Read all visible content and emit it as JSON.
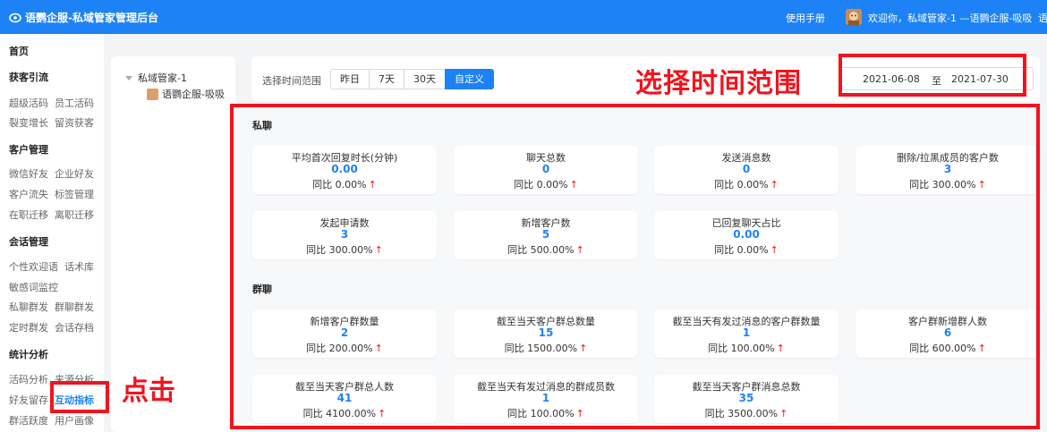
{
  "header": {
    "brand": "语鹦企服-私域管家管理后台",
    "manual": "使用手册",
    "welcome": "欢迎你，私域管家-1 —语鹦企服-吸吸",
    "overflow": "语"
  },
  "sidebar": {
    "home": "首页",
    "sections": [
      {
        "title": "获客引流",
        "items": [
          "超级活码",
          "员工活码",
          "裂变增长",
          "留资获客"
        ]
      },
      {
        "title": "客户管理",
        "items": [
          "微信好友",
          "企业好友",
          "客户流失",
          "标签管理",
          "在职迁移",
          "离职迁移"
        ]
      },
      {
        "title": "会话管理",
        "items": [
          "个性欢迎语",
          "话术库",
          "敏感词监控",
          "私聊群发",
          "群聊群发",
          "定时群发",
          "会话存档"
        ]
      },
      {
        "title": "统计分析",
        "items": [
          "活码分析",
          "来源分析",
          "好友留存",
          "互动指标",
          "群活跃度",
          "用户画像"
        ]
      }
    ]
  },
  "tree": {
    "root": "私域管家-1",
    "child": "语鹦企服-吸吸"
  },
  "filter": {
    "label": "选择时间范围",
    "options": [
      "昨日",
      "7天",
      "30天",
      "自定义"
    ],
    "selected": "自定义",
    "date_start": "2021-06-08",
    "date_sep": "至",
    "date_end": "2021-07-30"
  },
  "annotations": {
    "time_range": "选择时间范围",
    "click": "点击",
    "color": "#f0141e"
  },
  "private_chat": {
    "title": "私聊",
    "cards": [
      {
        "label": "平均首次回复时长(分钟)",
        "value": "0.00",
        "compare": "同比 0.00%"
      },
      {
        "label": "聊天总数",
        "value": "0",
        "compare": "同比 0.00%"
      },
      {
        "label": "发送消息数",
        "value": "0",
        "compare": "同比 0.00%"
      },
      {
        "label": "删除/拉黑成员的客户数",
        "value": "3",
        "compare": "同比 300.00%"
      },
      {
        "label": "发起申请数",
        "value": "3",
        "compare": "同比 300.00%"
      },
      {
        "label": "新增客户数",
        "value": "5",
        "compare": "同比 500.00%"
      },
      {
        "label": "已回复聊天占比",
        "value": "0.00",
        "compare": "同比 0.00%"
      }
    ]
  },
  "group_chat": {
    "title": "群聊",
    "cards": [
      {
        "label": "新增客户群数量",
        "value": "2",
        "compare": "同比 200.00%"
      },
      {
        "label": "截至当天客户群总数量",
        "value": "15",
        "compare": "同比 1500.00%"
      },
      {
        "label": "截至当天有发过消息的客户群数量",
        "value": "1",
        "compare": "同比 100.00%"
      },
      {
        "label": "客户群新增群人数",
        "value": "6",
        "compare": "同比 600.00%"
      },
      {
        "label": "截至当天客户群总人数",
        "value": "41",
        "compare": "同比 4100.00%"
      },
      {
        "label": "截至当天有发过消息的群成员数",
        "value": "1",
        "compare": "同比 100.00%"
      },
      {
        "label": "截至当天客户群消息总数",
        "value": "35",
        "compare": "同比 3500.00%"
      }
    ]
  },
  "colors": {
    "primary": "#1d82f5",
    "accent_red": "#f0141e"
  },
  "icons": {
    "up": "up-arrow-icon"
  }
}
